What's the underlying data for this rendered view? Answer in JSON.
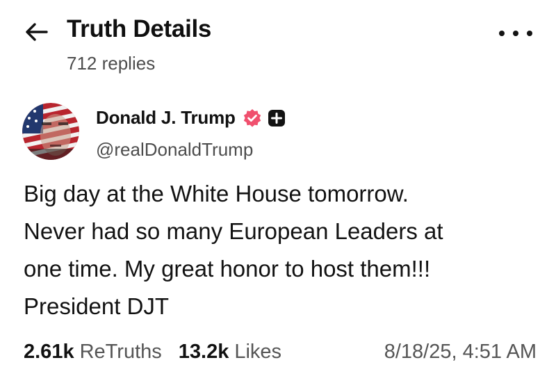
{
  "header": {
    "title": "Truth Details",
    "subtitle": "712 replies"
  },
  "post": {
    "author": {
      "name": "Donald J. Trump",
      "handle": "@realDonaldTrump"
    },
    "text": "Big day at the White House tomorrow.\nNever had so many European Leaders at\none time. My great honor to host them!!!\nPresident DJT",
    "stats": {
      "retruths_count": "2.61k",
      "retruths_label": "ReTruths",
      "likes_count": "13.2k",
      "likes_label": "Likes",
      "timestamp": "8/18/25, 4:51 AM"
    }
  },
  "colors": {
    "verified_badge": "#f0506e",
    "text_primary": "#111111",
    "text_secondary": "#555555"
  },
  "icons": [
    "back-arrow-icon",
    "more-options-icon",
    "verified-badge-icon",
    "plus-badge-icon"
  ]
}
